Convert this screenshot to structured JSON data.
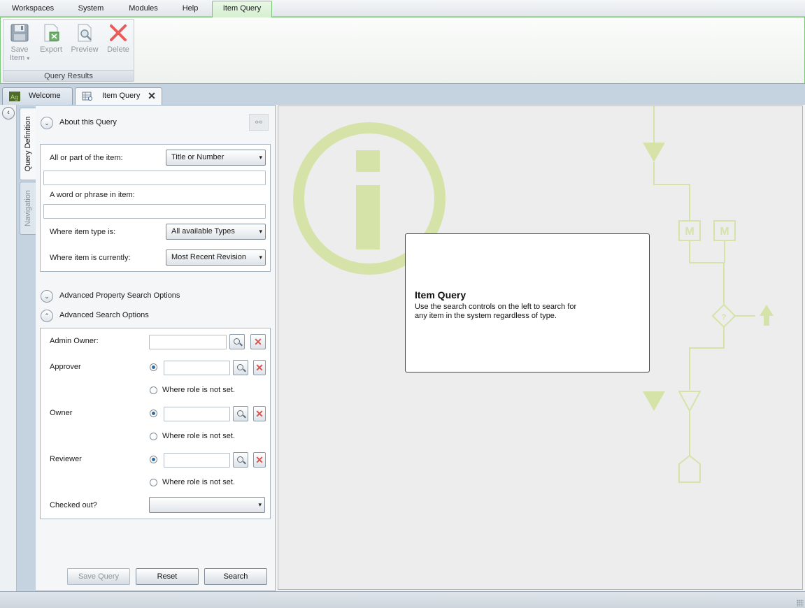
{
  "menu": {
    "workspaces": "Workspaces",
    "system": "System",
    "modules": "Modules",
    "help": "Help",
    "item_query": "Item Query"
  },
  "ribbon": {
    "save": "Save",
    "item": "Item",
    "export": "Export",
    "preview": "Preview",
    "delete": "Delete",
    "group_label": "Query Results"
  },
  "tabs": {
    "welcome": "Welcome",
    "item_query": "Item Query"
  },
  "side_tabs": {
    "query_definition": "Query Definition",
    "navigation": "Navigation"
  },
  "about": {
    "header": "About this Query"
  },
  "basic": {
    "all_or_part_label": "All or part of the item:",
    "all_or_part_select": "Title or Number",
    "all_or_part_value": "",
    "word_phrase_label": "A word or phrase in item:",
    "word_phrase_value": "",
    "item_type_label": "Where item type is:",
    "item_type_select": "All available Types",
    "item_current_label": "Where item is currently:",
    "item_current_select": "Most Recent Revision"
  },
  "advanced_property": {
    "header": "Advanced Property Search Options"
  },
  "advanced_search": {
    "header": "Advanced Search Options",
    "admin_owner_label": "Admin Owner:",
    "approver_label": "Approver",
    "owner_label": "Owner",
    "reviewer_label": "Reviewer",
    "not_set_label": "Where role is not set.",
    "checked_out_label": "Checked out?",
    "checked_out_value": ""
  },
  "buttons": {
    "save_query": "Save Query",
    "reset": "Reset",
    "search": "Search"
  },
  "info": {
    "title": "Item Query",
    "text": "Use the search controls on the left to search for any item in the system regardless of type."
  },
  "art": {
    "m_label": "M",
    "question_label": "?"
  },
  "colors": {
    "accent_green": "#7dc77a",
    "art_green": "#d6e3a8",
    "delete_red": "#dd5151",
    "radio_blue": "#2b6ea4"
  },
  "icons": {
    "save": "floppy-disk-icon",
    "export": "excel-export-icon",
    "preview": "magnifier-page-icon",
    "delete": "red-x-icon",
    "link": "link-chain-icon"
  }
}
